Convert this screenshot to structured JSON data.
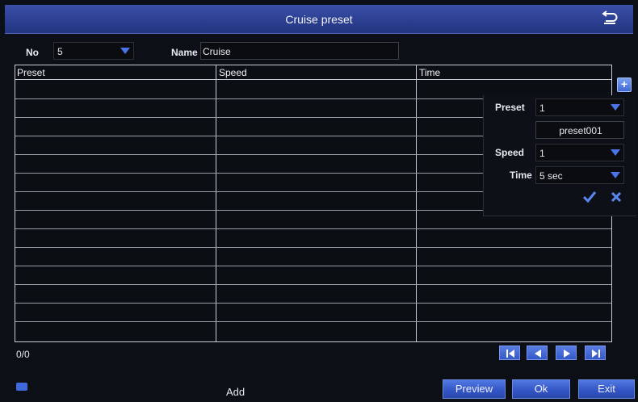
{
  "window": {
    "title": "Cruise preset",
    "back_icon": "return-icon"
  },
  "form": {
    "no_label": "No",
    "no_value": "5",
    "name_label": "Name",
    "name_value": "Cruise"
  },
  "table": {
    "columns": [
      "Preset",
      "Speed",
      "Time"
    ],
    "rows": []
  },
  "popup": {
    "preset_label": "Preset",
    "preset_value": "1",
    "preset_name": "preset001",
    "speed_label": "Speed",
    "speed_value": "1",
    "time_label": "Time",
    "time_value": "5 sec"
  },
  "pager": {
    "count": "0/0"
  },
  "footer": {
    "add_label": "Add",
    "preview_label": "Preview",
    "ok_label": "Ok",
    "exit_label": "Exit"
  },
  "colors": {
    "accent": "#3f68d8",
    "titlebar": "#2c3f92"
  }
}
